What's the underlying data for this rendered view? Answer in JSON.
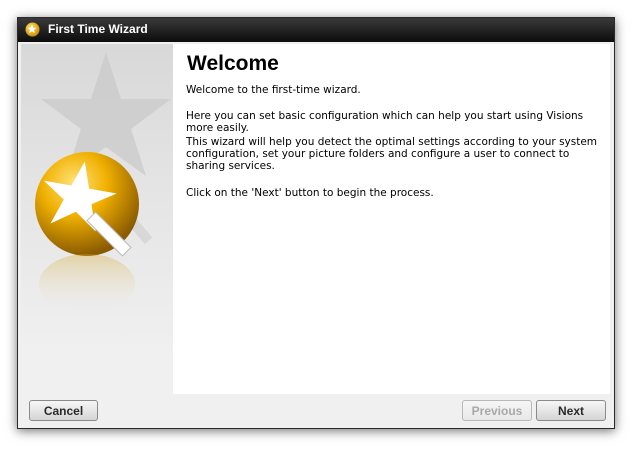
{
  "window": {
    "title": "First Time Wizard",
    "icon": "wizard-star-icon"
  },
  "content": {
    "heading": "Welcome",
    "paragraphs": [
      "Welcome to the first-time wizard.",
      "Here you can set basic configuration which can help you start using Visions more easily.",
      "This wizard will help you detect the optimal settings according to your system configuration, set your picture folders and configure a user to connect to sharing services.",
      "Click on the 'Next' button to begin the process."
    ]
  },
  "buttons": {
    "cancel": "Cancel",
    "previous": "Previous",
    "next": "Next"
  },
  "colors": {
    "titlebar": "#1a1a1a",
    "accent_gold": "#e8a800"
  }
}
